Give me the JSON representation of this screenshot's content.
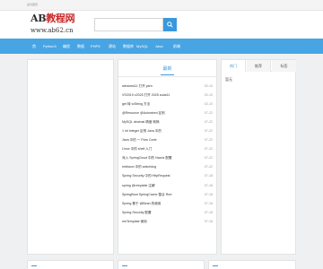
{
  "topbar": {
    "link": "设为首页"
  },
  "header": {
    "logo_line1_a": "AB",
    "logo_line1_b": "教程网",
    "logo_line2": "www.ab62.cn"
  },
  "search": {
    "placeholder": "",
    "button_icon": "search-icon"
  },
  "nav": {
    "items": [
      "首",
      "Python3",
      "编程",
      "数据",
      "PHP5",
      "建站",
      "数据库",
      "MySQL",
      "Java",
      "前端"
    ]
  },
  "middle": {
    "title": "最新",
    "articles": [
      {
        "title": "windows11 打开 yarn",
        "date": "02-10"
      },
      {
        "title": "VS2019 c2025 打开 2025 cuda11",
        "date": "02-10"
      },
      {
        "title": "get 转 toString 方法",
        "date": "02-10"
      },
      {
        "title": "@Resource @Autowired 区别",
        "date": "07-22"
      },
      {
        "title": "MySQL decimal 精度 转换",
        "date": "07-22"
      },
      {
        "title": "1 int Integer 区别 Java 中的",
        "date": "07-22"
      },
      {
        "title": "Java 中的 一 Flow Contr",
        "date": "07-22"
      },
      {
        "title": "Linux 中的 shell 入门",
        "date": "07-22"
      },
      {
        "title": "深入 SpringCloud 中的 Nacos 配置",
        "date": "07-22"
      },
      {
        "title": "redisson 中的 watchdog",
        "date": "07-22"
      },
      {
        "title": "Spring Security 中的 HttpRequest",
        "date": "07-18"
      },
      {
        "title": "spring @retryable 注解",
        "date": "07-18"
      },
      {
        "title": "SpringBoot SpringCache 整合 Red",
        "date": "07-18"
      },
      {
        "title": "Spring 基于 @Bean 的使用",
        "date": "07-18"
      },
      {
        "title": "Spring Security 配置",
        "date": "07-18"
      },
      {
        "title": "resTemplate 使用",
        "date": "07-18"
      }
    ]
  },
  "right": {
    "tabs": [
      "热门",
      "推荐",
      "标签"
    ],
    "content": "暂无"
  }
}
